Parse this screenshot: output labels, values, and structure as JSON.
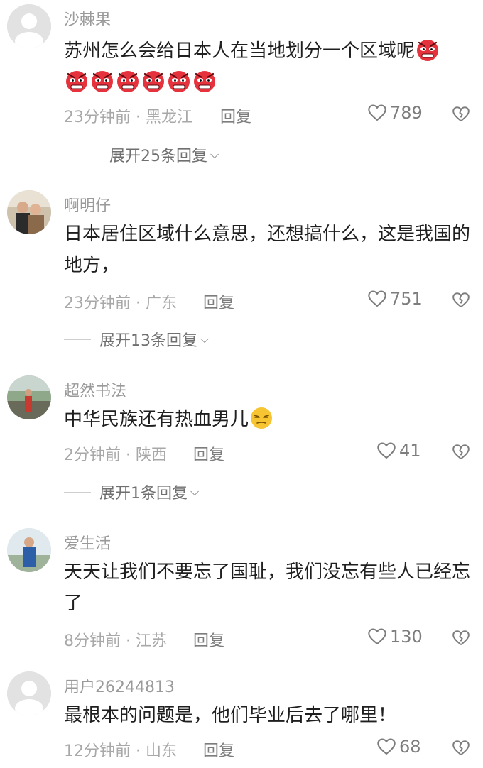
{
  "reply_label": "回复",
  "comments": [
    {
      "username": "沙棘果",
      "text": "苏州怎么会给日本人在当地划分一个区域呢",
      "emoji": "angry-face-emoji",
      "emoji_count": 7,
      "meta": "23分钟前 · 黑龙江",
      "likes": "789",
      "expand": "展开25条回复"
    },
    {
      "username": "啊明仔",
      "text": "日本居住区域什么意思，还想搞什么，这是我国的地方，",
      "meta": "23分钟前 · 广东",
      "likes": "751",
      "expand": "展开13条回复"
    },
    {
      "username": "超然书法",
      "text": "中华民族还有热血男儿",
      "emoji": "smirk-face-emoji",
      "meta": "2分钟前 · 陕西",
      "likes": "41",
      "expand": "展开1条回复"
    },
    {
      "username": "爱生活",
      "text": "天天让我们不要忘了国耻，我们没忘有些人已经忘了",
      "meta": "8分钟前 · 江苏",
      "likes": "130"
    },
    {
      "username": "用户26244813",
      "text": "最根本的问题是，他们毕业后去了哪里！",
      "meta": "12分钟前 · 山东",
      "likes": "68"
    }
  ],
  "colors": {
    "angry_emoji": "#e6323c",
    "smirk_emoji": "#f7c531",
    "muted_text": "#a8a8a8"
  }
}
